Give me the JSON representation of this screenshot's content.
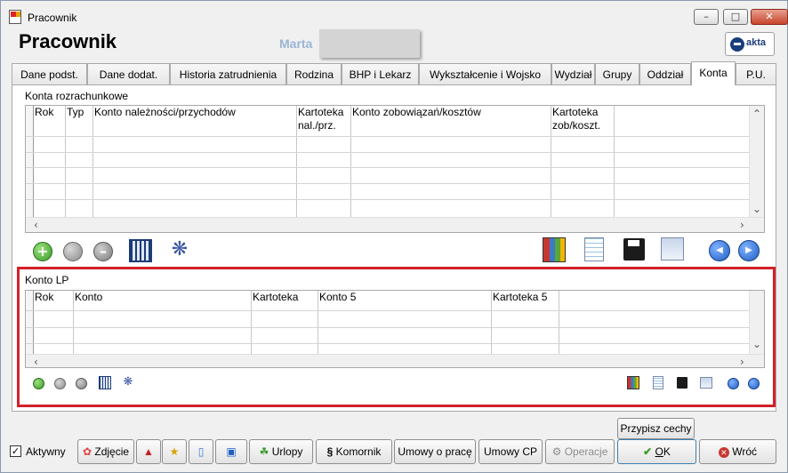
{
  "window": {
    "title": "Pracownik",
    "minimize": "–",
    "maximize": "□",
    "close": "✕"
  },
  "header": {
    "title": "Pracownik",
    "name": "Marta",
    "logo_text": "akta"
  },
  "tabs": [
    {
      "label": "Dane podst.",
      "active": false
    },
    {
      "label": "Dane dodat.",
      "active": false
    },
    {
      "label": "Historia zatrudnienia",
      "active": false
    },
    {
      "label": "Rodzina",
      "active": false
    },
    {
      "label": "BHP i Lekarz",
      "active": false
    },
    {
      "label": "Wykształcenie i Wojsko",
      "active": false
    },
    {
      "label": "Wydział",
      "active": false
    },
    {
      "label": "Grupy",
      "active": false
    },
    {
      "label": "Oddział",
      "active": false
    },
    {
      "label": "Konta",
      "active": true
    },
    {
      "label": "P.U.",
      "active": false
    }
  ],
  "konta_rozrachunkowe": {
    "label": "Konta rozrachunkowe",
    "columns": [
      "Rok",
      "Typ",
      "Konto należności/przychodów",
      "Kartoteka nal./prz.",
      "Konto zobowiązań/kosztów",
      "Kartoteka zob/koszt."
    ],
    "toolbar_left": [
      "add-icon",
      "view-icon",
      "remove-icon",
      "filter-icon",
      "grid-icon"
    ],
    "toolbar_right": [
      "chart-icon",
      "spreadsheet-icon",
      "save-icon",
      "windows-icon",
      "first-icon",
      "last-icon"
    ]
  },
  "konto_lp": {
    "label": "Konto LP",
    "columns": [
      "Rok",
      "Konto",
      "Kartoteka",
      "Konto 5",
      "Kartoteka 5"
    ]
  },
  "footer": {
    "aktywny_label": "Aktywny",
    "aktywny_checked": true,
    "przypisz_cechy": "Przypisz cechy",
    "zdjecie": "Zdjęcie",
    "urlopy": "Urlopy",
    "komornik": "Komornik",
    "umowy_o_prace": "Umowy o pracę",
    "umowy_cp": "Umowy CP",
    "operacje": "Operacje",
    "ok": "OK",
    "ok_mnemonic": "O",
    "wroc": "Wróć"
  },
  "colors": {
    "highlight_border": "#d3202a",
    "add": "#3a9a2a",
    "first_last": "#1f5fc4"
  }
}
